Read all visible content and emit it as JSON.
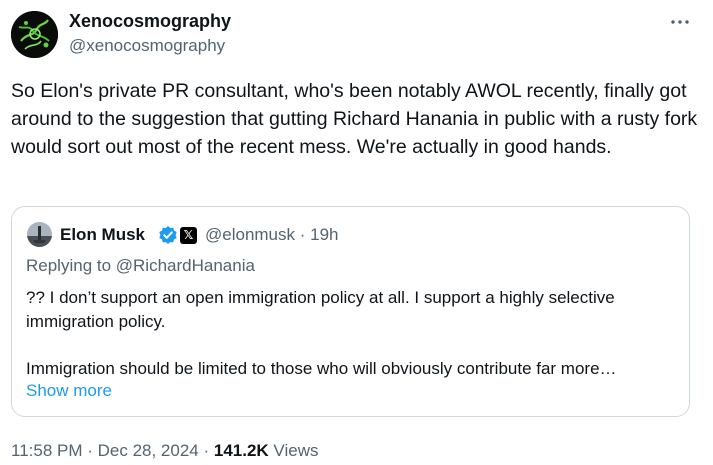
{
  "author": {
    "display_name": "Xenocosmography",
    "handle": "@xenocosmography"
  },
  "tweet": {
    "text": "So Elon's private PR consultant, who's been notably AWOL recently, finally got around to the suggestion that gutting Richard Hanania in public with a rusty fork would sort out most of the recent mess. We're actually in good hands."
  },
  "quoted": {
    "display_name": "Elon Musk",
    "affiliate_badge": "𝕏",
    "handle_time": "@elonmusk · 19h",
    "replying_to": "Replying to @RichardHanania",
    "paragraph_1": "?? I don’t support an open immigration policy at all. I support a highly selective immigration policy.",
    "paragraph_2": "Immigration should be limited to those who will obviously contribute far more…",
    "show_more": "Show more"
  },
  "meta": {
    "time": "11:58 PM",
    "sep1": " · ",
    "date": "Dec 28, 2024",
    "sep2": " · ",
    "views_count": "141.2K",
    "views_label": " Views"
  },
  "icons": {
    "more": "more-horizontal-icon",
    "verified": "verified-badge-icon"
  },
  "colors": {
    "accent": "#1d9bf0",
    "secondary_text": "#536471",
    "border": "#cfd9de"
  }
}
